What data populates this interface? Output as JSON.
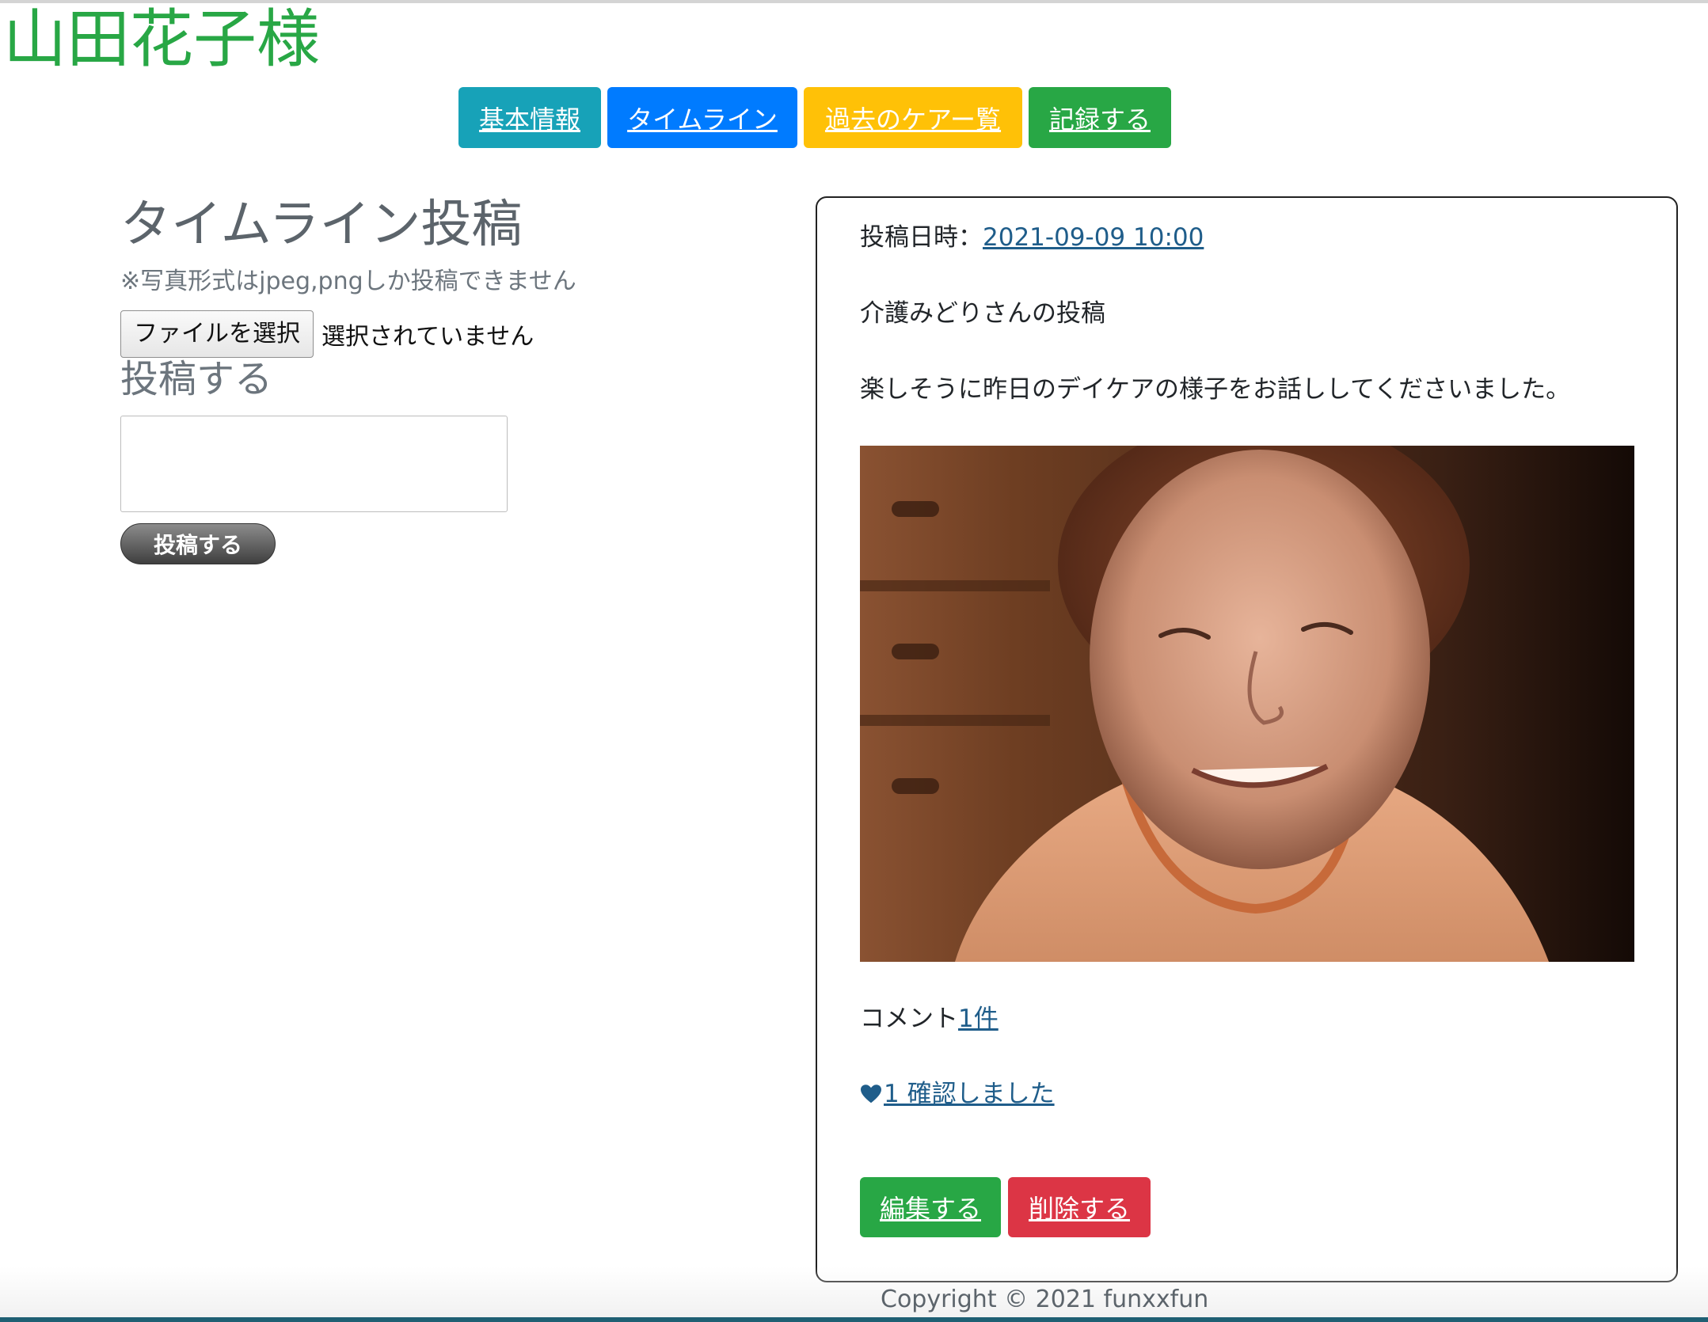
{
  "header": {
    "patient_name": "山田花子様"
  },
  "nav": {
    "info": "基本情報",
    "timeline": "タイムライン",
    "history": "過去のケアー覧",
    "record": "記録する"
  },
  "post_form": {
    "title": "タイムライン投稿",
    "note": "※写真形式はjpeg,pngしか投稿できません",
    "file_button": "ファイルを選択",
    "file_status": "選択されていません",
    "textarea_label": "投稿する",
    "textarea_value": "",
    "submit_label": "投稿する"
  },
  "post": {
    "datetime_label": "投稿日時：",
    "datetime_value": "2021-09-09 10:00",
    "author": "介護みどりさんの投稿",
    "body": "楽しそうに昨日のデイケアの様子をお話ししてくださいました。",
    "comment_label": "コメント",
    "comment_count": "1件",
    "confirm_text": "1 確認しました",
    "edit_label": "編集する",
    "delete_label": "削除する"
  },
  "footer": {
    "copyright": "Copyright © 2021 funxxfun"
  },
  "colors": {
    "green": "#28a745",
    "info": "#17a2b8",
    "primary": "#007bff",
    "warning": "#ffc107",
    "danger": "#dc3545",
    "link": "#1f5d8a"
  },
  "icons": {
    "heart": "heart-icon"
  }
}
